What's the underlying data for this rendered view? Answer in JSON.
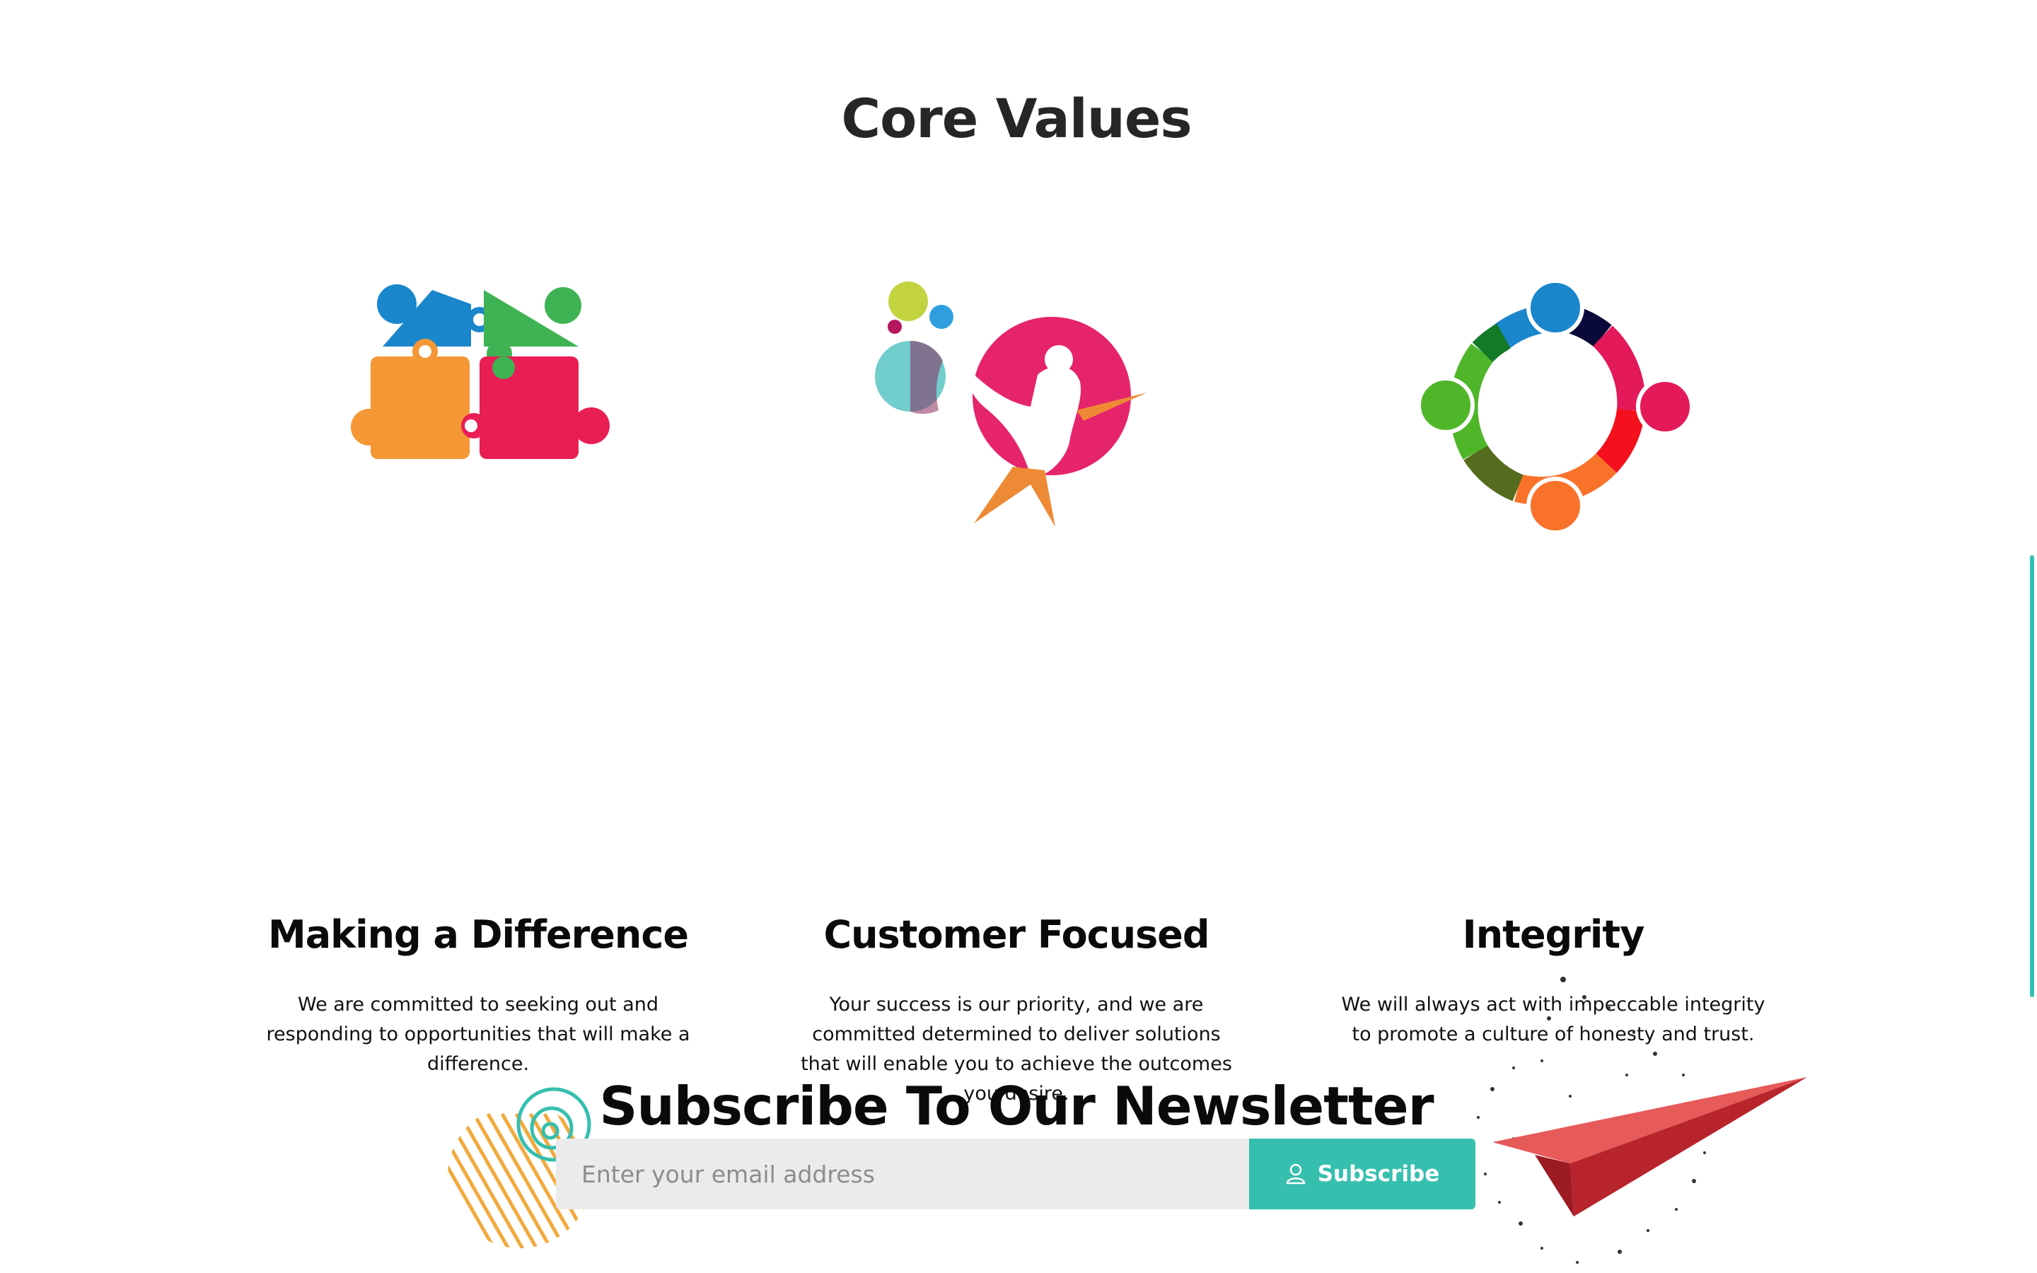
{
  "core_values": {
    "title": "Core Values",
    "items": [
      {
        "icon": "puzzle-pieces-icon",
        "title": "Making a Difference",
        "description": "We are committed to seeking out and responding to opportunities that will make a difference."
      },
      {
        "icon": "person-circle-icon",
        "title": "Customer Focused",
        "description": "Your success is our priority, and we are committed determined to deliver solutions that will enable you to achieve the outcomes you desire."
      },
      {
        "icon": "people-circle-icon",
        "title": "Integrity",
        "description": "We will always act with impeccable integrity to promote a culture of honesty and trust."
      }
    ]
  },
  "newsletter": {
    "title": "Subscribe To Our Newsletter",
    "email_placeholder": "Enter your email address",
    "email_value": "",
    "subscribe_label": "Subscribe",
    "subscribe_icon": "user-icon"
  },
  "colors": {
    "accent": "#36bfae",
    "puzzle_blue": "#1a86cc",
    "puzzle_green": "#3fb354",
    "puzzle_orange": "#f59734",
    "puzzle_red": "#e91e54",
    "plane_red": "#e65a5a"
  }
}
